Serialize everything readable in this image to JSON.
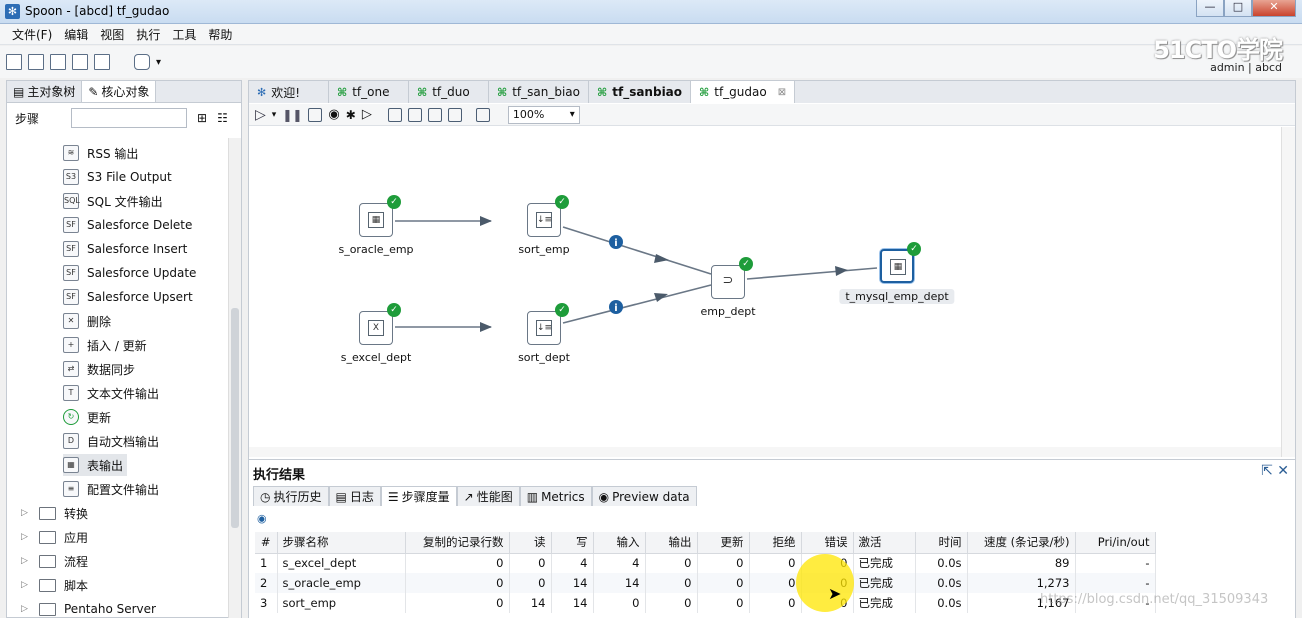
{
  "window": {
    "title": "Spoon - [abcd] tf_gudao",
    "min": "—",
    "max": "□",
    "close": "✕"
  },
  "menu": [
    "文件(F)",
    "编辑",
    "视图",
    "执行",
    "工具",
    "帮助"
  ],
  "brand": {
    "logo": "51CTO学院",
    "user": "admin | abcd"
  },
  "left": {
    "tabs": [
      "主对象树",
      "核心对象"
    ],
    "search_label": "步骤",
    "search_value": "",
    "items": [
      "RSS 输出",
      "S3 File Output",
      "SQL 文件输出",
      "Salesforce Delete",
      "Salesforce Insert",
      "Salesforce Update",
      "Salesforce Upsert",
      "删除",
      "插入 / 更新",
      "数据同步",
      "文本文件输出",
      "更新",
      "自动文档输出",
      "表输出",
      "配置文件输出"
    ],
    "folders": [
      "转换",
      "应用",
      "流程",
      "脚本",
      "Pentaho Server"
    ]
  },
  "editor": {
    "tabs": [
      "欢迎!",
      "tf_one",
      "tf_duo",
      "tf_san_biao",
      "tf_sanbiao",
      "tf_gudao"
    ],
    "zoom": "100%"
  },
  "nodes": {
    "s_oracle_emp": "s_oracle_emp",
    "s_excel_dept": "s_excel_dept",
    "sort_emp": "sort_emp",
    "sort_dept": "sort_dept",
    "emp_dept": "emp_dept",
    "t_mysql_emp_dept": "t_mysql_emp_dept"
  },
  "results": {
    "title": "执行结果",
    "tabs": [
      "执行历史",
      "日志",
      "步骤度量",
      "性能图",
      "Metrics",
      "Preview data"
    ],
    "columns": [
      "#",
      "步骤名称",
      "复制的记录行数",
      "读",
      "写",
      "输入",
      "输出",
      "更新",
      "拒绝",
      "错误",
      "激活",
      "时间",
      "速度 (条记录/秒)",
      "Pri/in/out"
    ],
    "rows": [
      [
        "1",
        "s_excel_dept",
        "0",
        "0",
        "4",
        "4",
        "0",
        "0",
        "0",
        "0",
        "已完成",
        "0.0s",
        "89",
        "-"
      ],
      [
        "2",
        "s_oracle_emp",
        "0",
        "0",
        "14",
        "14",
        "0",
        "0",
        "0",
        "0",
        "已完成",
        "0.0s",
        "1,273",
        "-"
      ],
      [
        "3",
        "sort_emp",
        "0",
        "14",
        "14",
        "0",
        "0",
        "0",
        "0",
        "0",
        "已完成",
        "0.0s",
        "1,167",
        "-"
      ]
    ]
  },
  "watermark": "https://blog.csdn.net/qq_31509343"
}
